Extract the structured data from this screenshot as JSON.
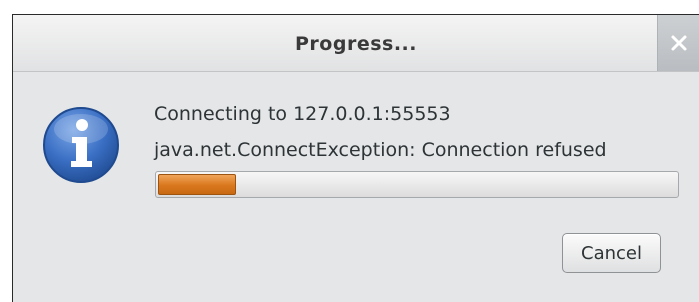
{
  "dialog": {
    "title": "Progress...",
    "close_label": "×"
  },
  "message": {
    "line1": "Connecting to 127.0.0.1:55553",
    "line2": "java.net.ConnectException: Connection refused"
  },
  "progress": {
    "value_percent": 15
  },
  "actions": {
    "cancel_label": "Cancel"
  },
  "icons": {
    "info": "info-icon",
    "close": "close-icon"
  },
  "colors": {
    "progress_fill": "#d9771d",
    "info_icon": "#2f63b8"
  }
}
